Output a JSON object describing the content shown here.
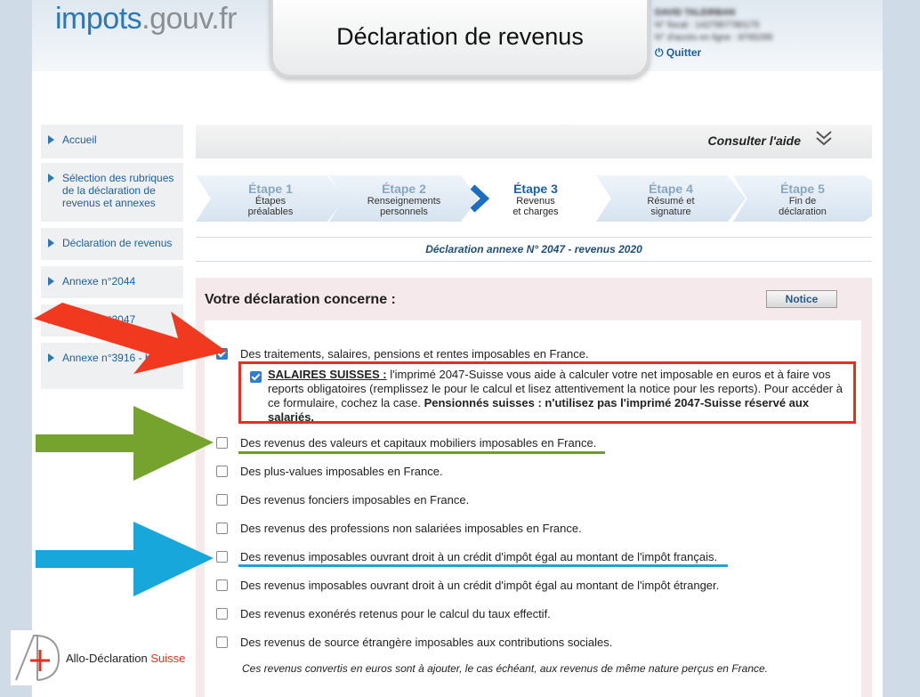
{
  "header": {
    "logo_part1": "impots",
    "logo_part2": ".gouv.fr",
    "title": "Déclaration de revenus",
    "user_name": "DAVID TALEIRBAN",
    "user_fiscal": "N° fiscal : 1427957780175",
    "user_access": "N° d'accès en ligne : 8765295",
    "quit_label": "Quitter"
  },
  "sidebar": {
    "items": [
      {
        "label": "Accueil"
      },
      {
        "label": "Sélection des rubriques de la déclaration de revenus et annexes"
      },
      {
        "label": "Déclaration de revenus"
      },
      {
        "label": "Annexe n°2044"
      },
      {
        "label": "Annexe n°2047"
      },
      {
        "label": "Annexe n°3916 - bis"
      }
    ]
  },
  "help": {
    "label": "Consulter l'aide",
    "chevron": "⌄"
  },
  "steps": [
    {
      "title": "Étape 1",
      "sub1": "Étapes",
      "sub2": "préalables"
    },
    {
      "title": "Étape 2",
      "sub1": "Renseignements",
      "sub2": "personnels"
    },
    {
      "title": "Étape 3",
      "sub1": "Revenus",
      "sub2": "et charges"
    },
    {
      "title": "Étape 4",
      "sub1": "Résumé et",
      "sub2": "signature"
    },
    {
      "title": "Étape 5",
      "sub1": "Fin de",
      "sub2": "déclaration"
    }
  ],
  "annexe_title": "Déclaration annexe N° 2047 - revenus 2020",
  "panel": {
    "title": "Votre déclaration concerne :",
    "notice_label": "Notice",
    "options": [
      {
        "label": "Des traitements, salaires, pensions et rentes imposables en France.",
        "checked": true
      },
      {
        "label": "Des revenus des valeurs et capitaux mobiliers imposables en France.",
        "checked": false
      },
      {
        "label": "Des plus-values imposables en France.",
        "checked": false
      },
      {
        "label": "Des revenus fonciers imposables en France.",
        "checked": false
      },
      {
        "label": "Des revenus des professions non salariées imposables en France.",
        "checked": false
      },
      {
        "label": "Des revenus imposables ouvrant droit à un crédit d'impôt égal au montant de l'impôt français.",
        "checked": false
      },
      {
        "label": "Des revenus imposables ouvrant droit à un crédit d'impôt égal au montant de l'impôt étranger.",
        "checked": false
      },
      {
        "label": "Des revenus exonérés retenus pour le calcul du taux effectif.",
        "checked": false
      },
      {
        "label": "Des revenus de source étrangère imposables aux contributions sociales.",
        "checked": false
      }
    ],
    "swiss": {
      "checked": true,
      "heading": "SALAIRES SUISSES :",
      "body": " l'imprimé 2047-Suisse vous aide à calculer votre net imposable en euros et à faire vos reports obligatoires (remplissez le pour le calcul et lisez attentivement la notice pour les reports). Pour accéder à ce formulaire, cochez la case. ",
      "warning": "Pensionnés suisses : n'utilisez pas l'imprimé 2047-Suisse réservé aux salariés."
    },
    "footnote": "Ces revenus convertis en euros sont à ajouter, le cas échéant, aux revenus de même nature perçus en France."
  },
  "brand": {
    "name_part1": "Allo-Déclaration ",
    "name_part2": "Suisse"
  },
  "colors": {
    "accent_blue": "#1c5f9e",
    "annotation_red": "#e53020",
    "annotation_green": "#6f9a2e",
    "annotation_cyan": "#1fa3d6"
  }
}
